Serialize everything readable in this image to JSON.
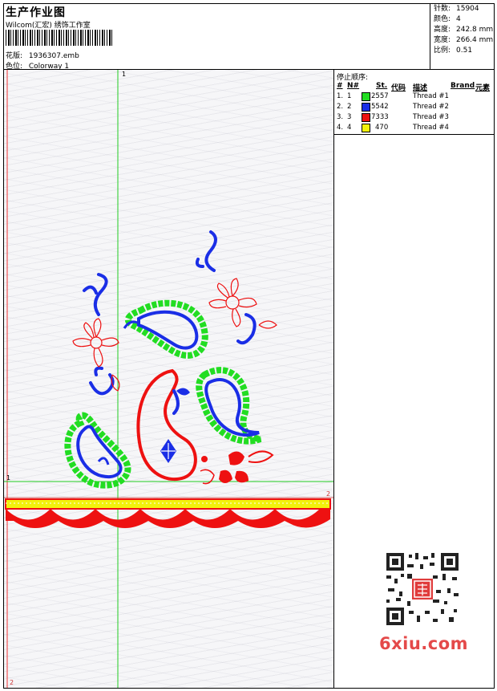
{
  "header": {
    "title": "生产作业图",
    "subtitle": "Wilcom(汇宏) 绣饰工作室",
    "design_label": "花版:",
    "design_value": "1936307.emb",
    "colorway_label": "色位:",
    "colorway_value": "Colorway 1"
  },
  "stats": {
    "stitches_label": "针数:",
    "stitches_value": "15904",
    "colors_label": "颜色:",
    "colors_value": "4",
    "height_label": "高度:",
    "height_value": "242.8 mm",
    "width_label": "宽度:",
    "width_value": "266.4 mm",
    "scale_label": "比例:",
    "scale_value": "0.51"
  },
  "stop_sequence": {
    "title": "停止顺序:",
    "headers": {
      "hash": "#",
      "n": "N#",
      "st": "St.",
      "code": "代码",
      "desc": "描述",
      "brand": "Brand",
      "element": "元素"
    },
    "rows": [
      {
        "num": "1.",
        "n": "1",
        "color": "#22dd22",
        "code": "2557",
        "desc": "Thread #1"
      },
      {
        "num": "2.",
        "n": "2",
        "color": "#1a2ee6",
        "code": "5542",
        "desc": "Thread #2"
      },
      {
        "num": "3.",
        "n": "3",
        "color": "#ee1111",
        "code": "7333",
        "desc": "Thread #3"
      },
      {
        "num": "4.",
        "n": "4",
        "color": "#f2f20c",
        "code": "470",
        "desc": "Thread #4"
      }
    ]
  },
  "markers": {
    "v1": "1",
    "h1": "1",
    "h2": "2",
    "v2": "2"
  },
  "watermark": {
    "site": "6xiu.com",
    "qr": "qr-code-icon"
  },
  "colors": {
    "green": "#22dd22",
    "blue": "#1a2ee6",
    "red": "#ee1111",
    "yellow": "#f2f20c",
    "guide": "#22cc22"
  }
}
